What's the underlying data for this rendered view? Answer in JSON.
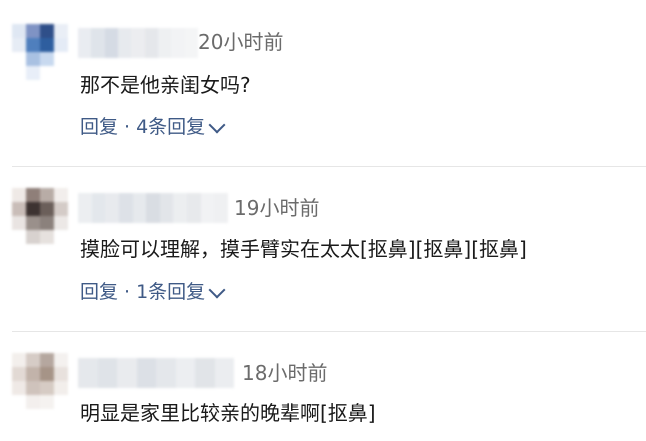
{
  "comments": [
    {
      "time": "20小时前",
      "text": "那不是他亲闺女吗?",
      "reply_label": "回复",
      "separator": "·",
      "replies_label": "4条回复",
      "avatar_colors": [
        "#dfe7f3",
        "#7f93c4",
        "#2f4f89",
        "#e9eef6",
        "#e6ecf5",
        "#4f7fbd",
        "#2e5e9f",
        "#e4ebf6",
        "#ffffff",
        "#a9c1e2",
        "#c8d9ef",
        "#ffffff",
        "#ffffff",
        "#e8eef8",
        "#ffffff",
        "#ffffff"
      ],
      "name_colors": [
        "#e9ecf1",
        "#dfe4ea",
        "#d5dbe4",
        "#e7eaee",
        "#ecedf0",
        "#e5e7eb",
        "#eef0f2",
        "#f2f3f5",
        "#f4f5f6"
      ]
    },
    {
      "time": "19小时前",
      "text": "摸脸可以理解，摸手臂实在太太[抠鼻][抠鼻][抠鼻]",
      "reply_label": "回复",
      "separator": "·",
      "replies_label": "1条回复",
      "avatar_colors": [
        "#efe9e6",
        "#8f7f79",
        "#b8aca6",
        "#f2eeec",
        "#c9bdb8",
        "#3d3331",
        "#6b5f5a",
        "#d4cbc7",
        "#e9e4e2",
        "#9a908b",
        "#8b817c",
        "#ece8e6",
        "#ffffff",
        "#d8d2cf",
        "#e6e1de",
        "#ffffff"
      ],
      "name_colors": [
        "#eceef1",
        "#e3e7ec",
        "#e8eaee",
        "#dde1e7",
        "#e6e9ed",
        "#d9dde3",
        "#e2e5e9",
        "#eceef0",
        "#e7e9ec",
        "#f1f2f4",
        "#eff0f2"
      ]
    },
    {
      "time": "18小时前",
      "text": "明显是家里比较亲的晚辈啊[抠鼻]",
      "reply_label": "",
      "separator": "",
      "replies_label": "",
      "avatar_colors": [
        "#f3efec",
        "#d6ccc6",
        "#b5a79f",
        "#f4f1ef",
        "#e2d9d4",
        "#c2b3aa",
        "#a69487",
        "#e8e1dd",
        "#efe9e6",
        "#cfc3bc",
        "#d6cbc4",
        "#f2eeeb",
        "#ffffff",
        "#f3efed",
        "#f5f2f0",
        "#ffffff"
      ],
      "name_colors": [
        "#e5e8ec",
        "#dfe3e8",
        "#e9ebee",
        "#dce0e6",
        "#e4e7eb",
        "#eceef1",
        "#e1e4e8",
        "#ebedf0"
      ]
    }
  ]
}
